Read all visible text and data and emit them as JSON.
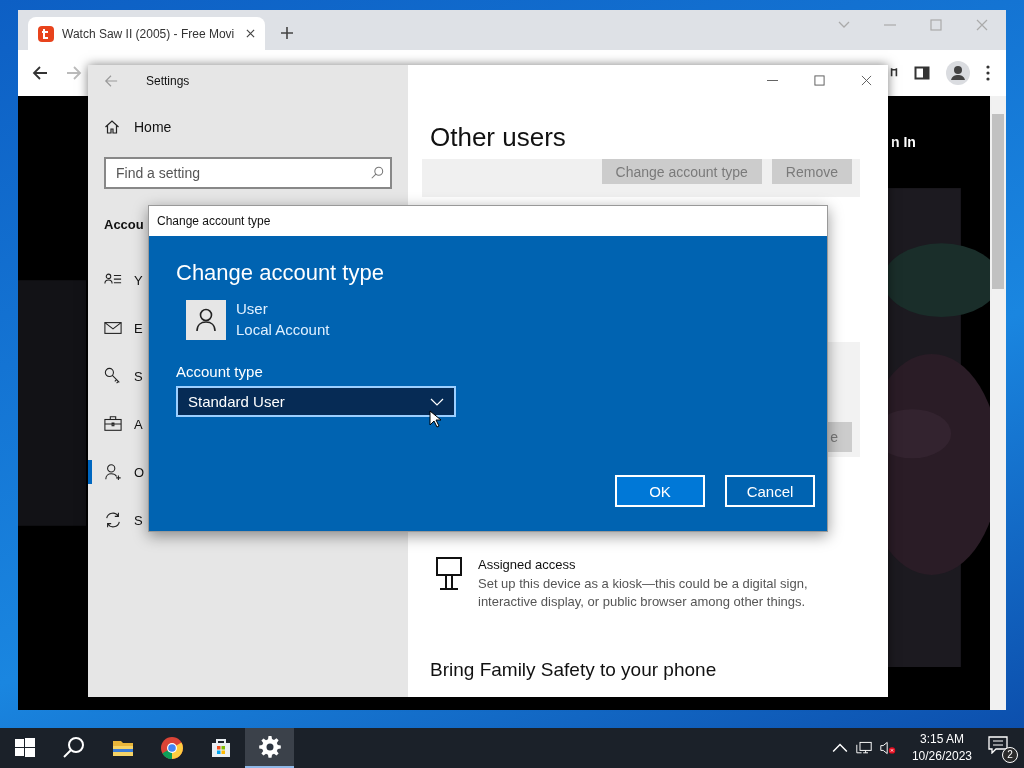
{
  "browser": {
    "tab": {
      "title": "Watch Saw II (2005) - Free Movi",
      "selected": true
    },
    "page_text": "n In"
  },
  "settings": {
    "title": "Settings",
    "home": "Home",
    "search": {
      "placeholder": "Find a setting"
    },
    "section": "Accou",
    "nav": [
      {
        "kind": "info",
        "label": "Y",
        "selected": false
      },
      {
        "kind": "mail",
        "label": "E",
        "selected": false
      },
      {
        "kind": "key",
        "label": "S",
        "selected": false
      },
      {
        "kind": "work",
        "label": "A",
        "selected": false
      },
      {
        "kind": "users",
        "label": "O",
        "selected": true
      },
      {
        "kind": "sync",
        "label": "S",
        "selected": false
      }
    ],
    "heading": "Other users",
    "buttons": [
      {
        "label": "Change account type",
        "disabled": true
      },
      {
        "label": "Remove",
        "disabled": true
      }
    ],
    "hidden_button_fragment": "e",
    "assigned_access": {
      "title": "Assigned access",
      "description": "Set up this device as a kiosk—this could be a digital sign, interactive display, or public browser among other things."
    },
    "family_heading": "Bring Family Safety to your phone"
  },
  "dialog": {
    "window_title": "Change account type",
    "heading": "Change account type",
    "user": {
      "name": "User",
      "account": "Local Account"
    },
    "field_label": "Account type",
    "select": {
      "value": "Standard User"
    },
    "buttons": [
      {
        "label": "OK",
        "kind": "primary"
      },
      {
        "label": "Cancel",
        "kind": "secondary"
      }
    ]
  },
  "taskbar": {
    "apps": [
      {
        "kind": "start",
        "selected": false
      },
      {
        "kind": "search",
        "selected": false
      },
      {
        "kind": "explorer",
        "selected": false
      },
      {
        "kind": "chrome",
        "selected": false
      },
      {
        "kind": "store",
        "selected": false
      },
      {
        "kind": "settings",
        "selected": true
      }
    ],
    "time": "3:15 AM",
    "date": "10/26/2023",
    "notifications": "2"
  }
}
